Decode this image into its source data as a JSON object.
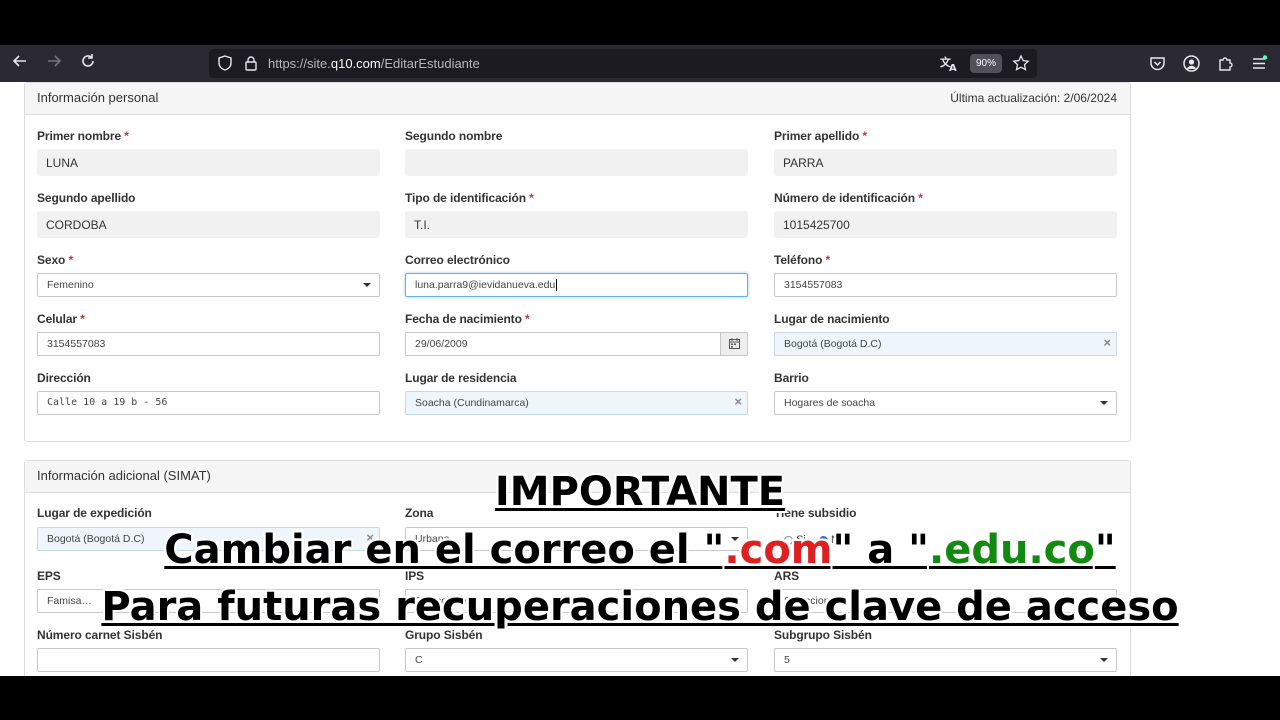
{
  "browser": {
    "url_prefix": "https://site.",
    "url_domain": "q10.com",
    "url_path": "/EditarEstudiante",
    "zoom": "90%"
  },
  "personal": {
    "title": "Información personal",
    "updated": "Última actualización: 2/06/2024",
    "fields": {
      "primer_nombre": {
        "label": "Primer nombre",
        "value": "LUNA"
      },
      "segundo_nombre": {
        "label": "Segundo nombre",
        "value": ""
      },
      "primer_apellido": {
        "label": "Primer apellido",
        "value": "PARRA"
      },
      "segundo_apellido": {
        "label": "Segundo apellido",
        "value": "CORDOBA"
      },
      "tipo_id": {
        "label": "Tipo de identificación",
        "value": "T.I."
      },
      "numero_id": {
        "label": "Número de identificación",
        "value": "1015425700"
      },
      "sexo": {
        "label": "Sexo",
        "value": "Femenino"
      },
      "correo": {
        "label": "Correo electrónico",
        "value": "luna.parra9@ievidanueva.edu"
      },
      "telefono": {
        "label": "Teléfono",
        "value": "3154557083"
      },
      "celular": {
        "label": "Celular",
        "value": "3154557083"
      },
      "fecha_nac": {
        "label": "Fecha de nacimiento",
        "value": "29/06/2009"
      },
      "lugar_nac": {
        "label": "Lugar de nacimiento",
        "value": "Bogotá (Bogotá D.C)"
      },
      "direccion": {
        "label": "Dirección",
        "value": "Calle 10 a 19 b - 56"
      },
      "residencia": {
        "label": "Lugar de residencia",
        "value": "Soacha (Cundinamarca)"
      },
      "barrio": {
        "label": "Barrio",
        "value": "Hogares de soacha"
      }
    }
  },
  "simat": {
    "title": "Información adicional (SIMAT)",
    "fields": {
      "expedicion": {
        "label": "Lugar de expedición",
        "value": "Bogotá (Bogotá D.C)"
      },
      "zona": {
        "label": "Zona",
        "value": "Urbana"
      },
      "subsidio": {
        "label": "Tiene subsidio",
        "opt_si": "Si",
        "opt_no": "No"
      },
      "eps": {
        "label": "EPS",
        "value": "Famisa…"
      },
      "ips": {
        "label": "IPS",
        "value": "Seleccione"
      },
      "ars": {
        "label": "ARS",
        "value": "Seleccione"
      },
      "carnet": {
        "label": "Número carnet Sisbén",
        "value": ""
      },
      "grupo": {
        "label": "Grupo Sisbén",
        "value": "C"
      },
      "subgrupo": {
        "label": "Subgrupo Sisbén",
        "value": "5"
      }
    }
  },
  "overlay": {
    "heading": "IMPORTANTE",
    "line1_a": "Cambiar en el correo el \"",
    "line1_com": ".com",
    "line1_b": "\" a \"",
    "line1_edu": ".edu.co",
    "line1_c": "\"",
    "line2": "Para futuras recuperaciones de clave de acceso"
  }
}
